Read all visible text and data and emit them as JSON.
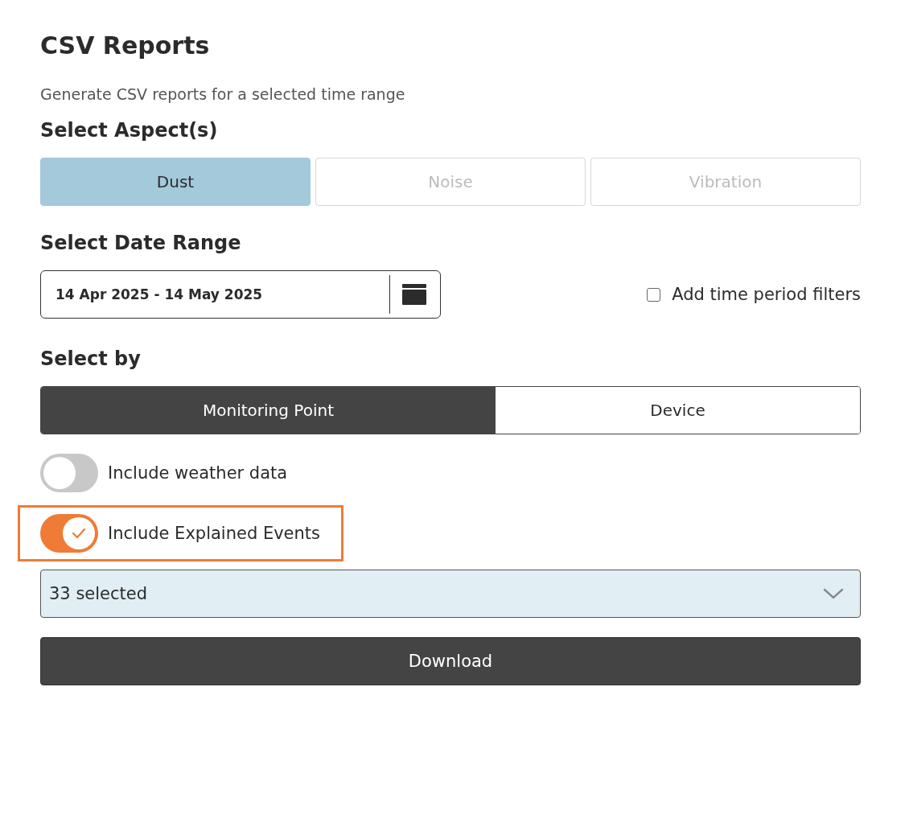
{
  "title": "CSV Reports",
  "subtitle": "Generate CSV reports for a selected time range",
  "aspects": {
    "heading": "Select Aspect(s)",
    "options": [
      {
        "label": "Dust",
        "selected": true
      },
      {
        "label": "Noise",
        "selected": false
      },
      {
        "label": "Vibration",
        "selected": false
      }
    ]
  },
  "date_range": {
    "heading": "Select Date Range",
    "value": "14 Apr 2025 - 14 May 2025",
    "time_filter": {
      "label": "Add time period filters",
      "checked": false
    }
  },
  "select_by": {
    "heading": "Select by",
    "options": [
      {
        "label": "Monitoring Point",
        "selected": true
      },
      {
        "label": "Device",
        "selected": false
      }
    ]
  },
  "toggles": [
    {
      "label": "Include weather data",
      "on": false,
      "highlighted": false
    },
    {
      "label": "Include Explained Events",
      "on": true,
      "highlighted": true
    }
  ],
  "multiselect": {
    "value": "33 selected"
  },
  "download_button": "Download"
}
